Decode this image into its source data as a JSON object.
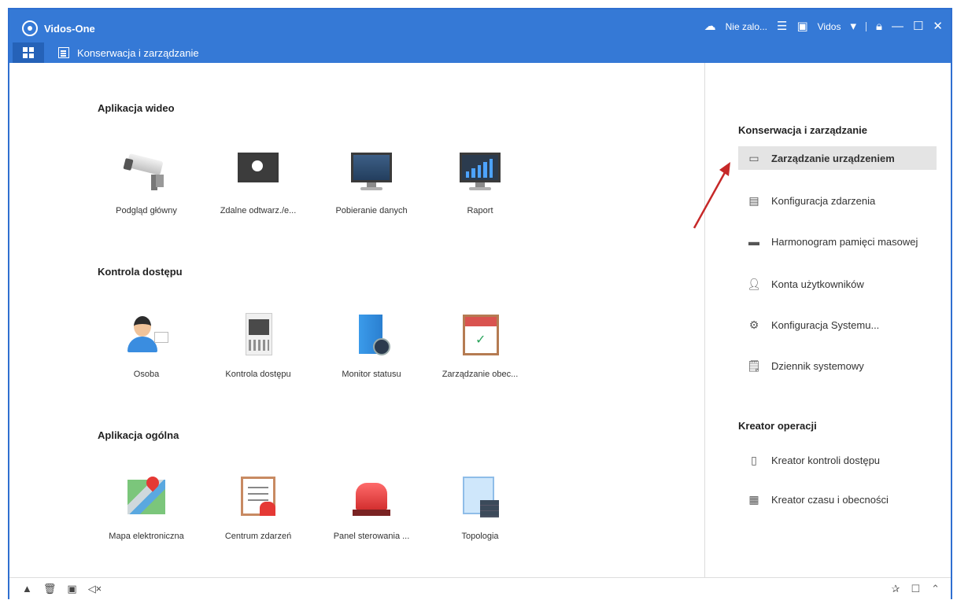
{
  "window": {
    "app_title": "Vidos-One",
    "tab_label": "Konserwacja i zarządzanie",
    "cloud_status": "Nie zalo...",
    "user_label": "Vidos"
  },
  "main": {
    "sections": [
      {
        "title": "Aplikacja wideo",
        "items": [
          {
            "label": "Podgląd główny",
            "icon": "camera-icon"
          },
          {
            "label": "Zdalne odtwarz./e...",
            "icon": "playback-icon"
          },
          {
            "label": "Pobieranie danych",
            "icon": "download-icon"
          },
          {
            "label": "Raport",
            "icon": "report-icon"
          }
        ]
      },
      {
        "title": "Kontrola dostępu",
        "items": [
          {
            "label": "Osoba",
            "icon": "person-icon"
          },
          {
            "label": "Kontrola dostępu",
            "icon": "access-control-icon"
          },
          {
            "label": "Monitor statusu",
            "icon": "status-monitor-icon"
          },
          {
            "label": "Zarządzanie obec...",
            "icon": "attendance-icon"
          }
        ]
      },
      {
        "title": "Aplikacja ogólna",
        "items": [
          {
            "label": "Mapa elektroniczna",
            "icon": "map-icon"
          },
          {
            "label": "Centrum zdarzeń",
            "icon": "event-center-icon"
          },
          {
            "label": "Panel sterowania ...",
            "icon": "alarm-panel-icon"
          },
          {
            "label": "Topologia",
            "icon": "topology-icon"
          }
        ]
      }
    ]
  },
  "sidebar": {
    "section1_title": "Konserwacja i zarządzanie",
    "section1_items": [
      {
        "label": "Zarządzanie urządzeniem",
        "icon": "device-icon"
      },
      {
        "label": "Konfiguracja zdarzenia",
        "icon": "event-config-icon"
      },
      {
        "label": "Harmonogram pamięci masowej",
        "icon": "storage-icon"
      },
      {
        "label": "Konta użytkowników",
        "icon": "user-icon"
      },
      {
        "label": "Konfiguracja Systemu...",
        "icon": "gear-icon"
      },
      {
        "label": "Dziennik systemowy",
        "icon": "log-icon"
      }
    ],
    "section2_title": "Kreator operacji",
    "section2_items": [
      {
        "label": "Kreator kontroli dostępu",
        "icon": "door-wizard-icon"
      },
      {
        "label": "Kreator czasu i obecności",
        "icon": "calendar-icon"
      }
    ]
  },
  "colors": {
    "titlebar": "#3579d6",
    "active_item": "#e4e4e4",
    "arrow": "#c62828"
  }
}
